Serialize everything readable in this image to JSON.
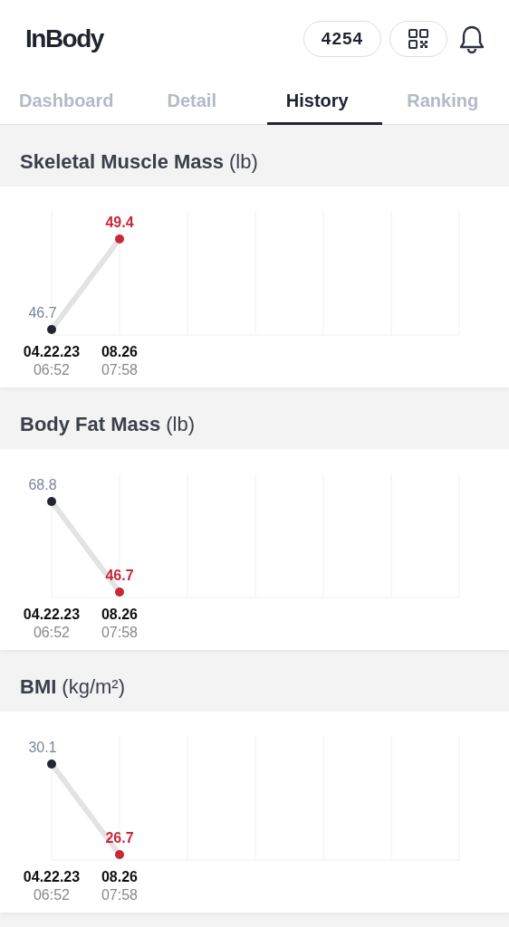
{
  "header": {
    "logo": "InBody",
    "points": "4254"
  },
  "tabs": [
    {
      "label": "Dashboard",
      "selected": false
    },
    {
      "label": "Detail",
      "selected": false
    },
    {
      "label": "History",
      "selected": true
    },
    {
      "label": "Ranking",
      "selected": false
    }
  ],
  "sections": [
    {
      "title": "Skeletal Muscle Mass",
      "unit": "(lb)",
      "points": [
        {
          "value": "46.7",
          "date": "04.22.23",
          "time": "06:52"
        },
        {
          "value": "49.4",
          "date": "08.26",
          "time": "07:58"
        }
      ]
    },
    {
      "title": "Body Fat Mass",
      "unit": "(lb)",
      "points": [
        {
          "value": "68.8",
          "date": "04.22.23",
          "time": "06:52"
        },
        {
          "value": "46.7",
          "date": "08.26",
          "time": "07:58"
        }
      ]
    },
    {
      "title": "BMI",
      "unit": "(kg/m²)",
      "points": [
        {
          "value": "30.1",
          "date": "04.22.23",
          "time": "06:52"
        },
        {
          "value": "26.7",
          "date": "08.26",
          "time": "07:58"
        }
      ]
    }
  ]
}
